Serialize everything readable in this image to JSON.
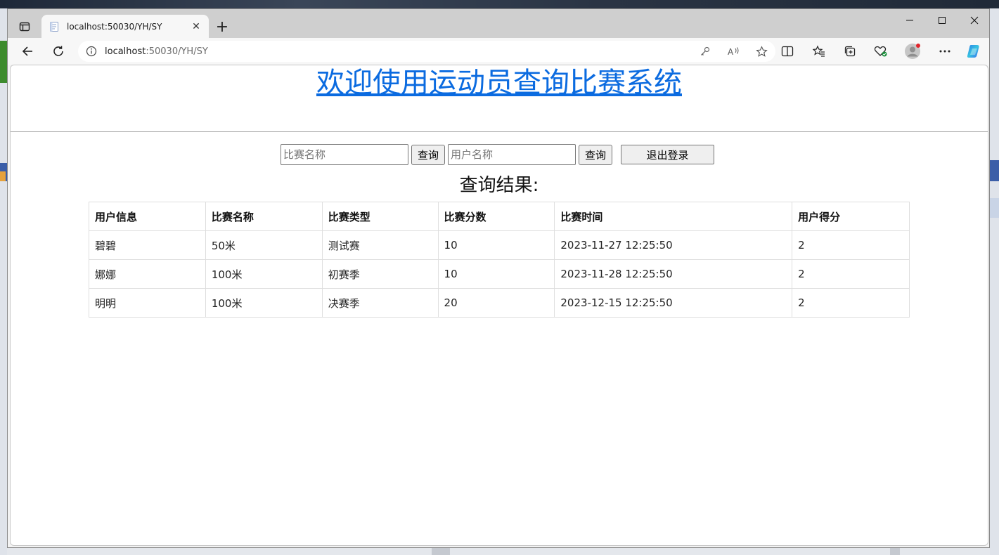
{
  "browser": {
    "tab_title": "localhost:50030/YH/SY",
    "url_host": "localhost",
    "url_path": ":50030/YH/SY"
  },
  "page": {
    "title": "欢迎使用运动员查询比赛系统",
    "search": {
      "match_placeholder": "比赛名称",
      "user_placeholder": "用户名称",
      "query_label_1": "查询",
      "query_label_2": "查询",
      "logout_label": "退出登录"
    },
    "result_title": "查询结果:",
    "table": {
      "headers": [
        "用户信息",
        "比赛名称",
        "比赛类型",
        "比赛分数",
        "比赛时间",
        "用户得分"
      ],
      "rows": [
        [
          "碧碧",
          "50米",
          "测试赛",
          "10",
          "2023-11-27 12:25:50",
          "2"
        ],
        [
          "娜娜",
          "100米",
          "初赛季",
          "10",
          "2023-11-28 12:25:50",
          "2"
        ],
        [
          "明明",
          "100米",
          "决赛季",
          "20",
          "2023-12-15 12:25:50",
          "2"
        ]
      ]
    }
  }
}
